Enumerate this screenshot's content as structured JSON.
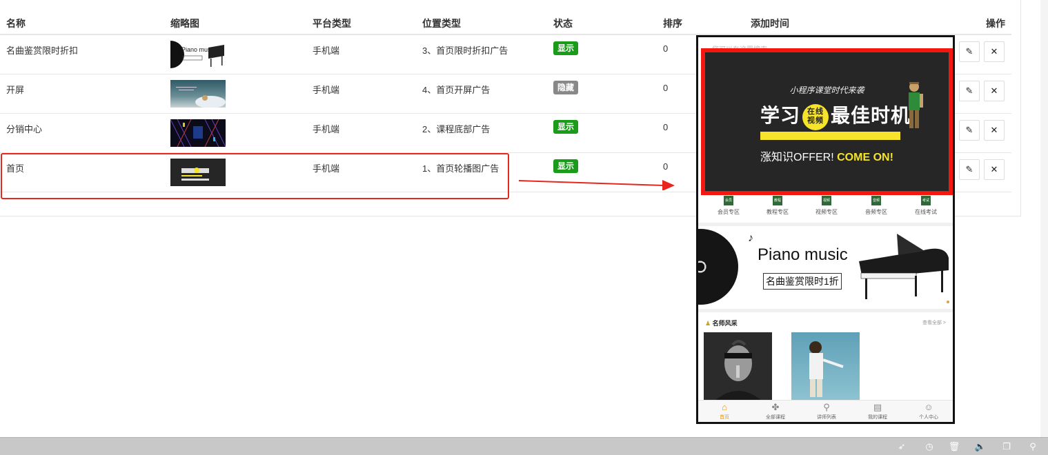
{
  "table": {
    "headers": {
      "name": "名称",
      "thumb": "缩略图",
      "platform": "平台类型",
      "position": "位置类型",
      "status": "状态",
      "sort": "排序",
      "time": "添加时间",
      "action": "操作"
    },
    "rows": [
      {
        "name": "名曲鉴赏限时折扣",
        "platform": "手机端",
        "position": "3、首页限时折扣广告",
        "status": "显示",
        "sort": "0"
      },
      {
        "name": "开屏",
        "platform": "手机端",
        "position": "4、首页开屏广告",
        "status": "隐藏",
        "sort": "0"
      },
      {
        "name": "分销中心",
        "platform": "手机端",
        "position": "2、课程底部广告",
        "status": "显示",
        "sort": "0"
      },
      {
        "name": "首页",
        "platform": "手机端",
        "position": "1、首页轮播图广告",
        "status": "显示",
        "sort": "0"
      }
    ]
  },
  "preview": {
    "search_hint": "您可以在这里搜索",
    "banner": {
      "sub": "小程序课堂时代来袭",
      "main_left": "学习",
      "circle_top": "在线",
      "circle_bottom": "视频",
      "main_right": "最佳时机",
      "slogan_white": "涨知识OFFER!",
      "slogan_yellow": "COME ON!"
    },
    "nav": [
      {
        "icon": "会员",
        "label": "会员专区"
      },
      {
        "icon": "教程",
        "label": "教程专区"
      },
      {
        "icon": "视频",
        "label": "视频专区"
      },
      {
        "icon": "音频",
        "label": "音频专区"
      },
      {
        "icon": "考试",
        "label": "在线考试"
      }
    ],
    "piano": {
      "title": "Piano music",
      "sub": "名曲鉴赏限时1折"
    },
    "teachers": {
      "title": "名师风采",
      "more": "查看全部 >"
    },
    "tabs": [
      {
        "label": "首页"
      },
      {
        "label": "全部课程"
      },
      {
        "label": "讲师列表"
      },
      {
        "label": "我的课程"
      },
      {
        "label": "个人中心"
      }
    ]
  },
  "colors": {
    "show": "#1a9b1a",
    "hide": "#888888",
    "highlight": "#e8261c",
    "accent": "#f5e42a"
  },
  "icons": {
    "edit": "pencil-icon",
    "delete": "close-icon",
    "taskbar": [
      "rocket-icon",
      "clock-icon",
      "trash-icon",
      "volume-icon",
      "window-icon",
      "search-icon"
    ]
  }
}
